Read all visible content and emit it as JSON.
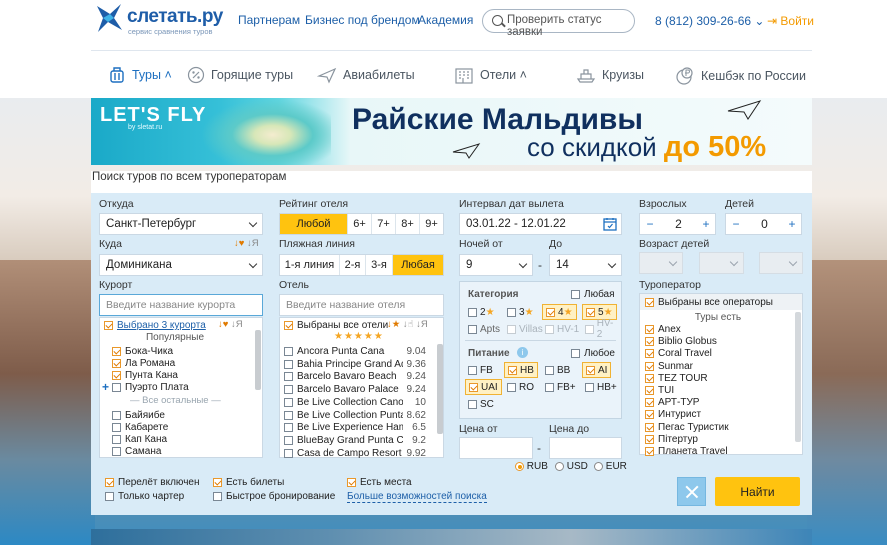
{
  "header": {
    "logo_text": "слетать.ру",
    "logo_sub": "сервис сравнения туров",
    "links": [
      "Партнерам",
      "Бизнес под брендом",
      "Академия"
    ],
    "status_btn": "Проверить статус заявки",
    "phone": "8 (812) 309-26-66 ⌄",
    "login": "Войти"
  },
  "nav": {
    "items": [
      "Туры",
      "Горящие туры",
      "Авиабилеты",
      "Отели",
      "Круизы",
      "Кешбэк по России"
    ]
  },
  "banner": {
    "brand": "LET'S FLY",
    "brand_sub": "by sletat.ru",
    "title": "Райские Мальдивы",
    "sub_prefix": "со скидкой ",
    "sub_hl": "до 50%"
  },
  "caption": "Поиск туров по всем туроператорам",
  "form": {
    "from_label": "Откуда",
    "from_value": "Санкт-Петербург",
    "to_label": "Куда",
    "to_value": "Доминикана",
    "resort_label": "Курорт",
    "resort_placeholder": "Введите название курорта",
    "resort_selected": "Выбрано 3 курорта",
    "resort_sort": "↓Я",
    "resort_popular": "Популярные",
    "resort_popular_items": [
      {
        "n": "Бока-Чика",
        "c": true
      },
      {
        "n": "Ла Романа",
        "c": true
      },
      {
        "n": "Пунта Кана",
        "c": true
      },
      {
        "n": "Пуэрто Плата",
        "c": false,
        "plus": true
      }
    ],
    "resort_rest": "Все остальные",
    "resort_rest_items": [
      "Байяибе",
      "Кабарете",
      "Кап Кана",
      "Самана"
    ],
    "rating_label": "Рейтинг отеля",
    "rating_opts": [
      "Любой",
      "6+",
      "7+",
      "8+",
      "9+"
    ],
    "beach_label": "Пляжная линия",
    "beach_opts": [
      "1-я линия",
      "2-я",
      "3-я",
      "Любая"
    ],
    "hotel_label": "Отель",
    "hotel_placeholder": "Введите название отеля",
    "hotel_selected": "Выбраны все отели",
    "hotel_sort": "↓Я",
    "hotel_stars": "★★★★★",
    "hotels": [
      {
        "n": "Ancora Punta Cana",
        "r": "9.04"
      },
      {
        "n": "Bahia Principe Grand Aqu",
        "r": "9.36"
      },
      {
        "n": "Barcelo Bavaro Beach",
        "r": "9.24"
      },
      {
        "n": "Barcelo Bavaro Palace",
        "r": "9.24"
      },
      {
        "n": "Be Live Collection Canoa",
        "r": "10"
      },
      {
        "n": "Be Live Collection Punta C",
        "r": "8.62"
      },
      {
        "n": "Be Live Experience Hama",
        "r": "6.5"
      },
      {
        "n": "BlueBay Grand Punta Can",
        "r": "9.2"
      },
      {
        "n": "Casa de Campo Resort &",
        "r": "9.92"
      }
    ],
    "dates_label": "Интервал дат вылета",
    "dates_value": "03.01.22 - 12.01.22",
    "nights_from_label": "Ночей от",
    "nights_from": "9",
    "nights_to_label": "До",
    "nights_to": "14",
    "nights_dash": "-",
    "category_label": "Категория",
    "category_any": "Любая",
    "cats": [
      {
        "n": "2",
        "c": false
      },
      {
        "n": "3",
        "c": false
      },
      {
        "n": "4",
        "c": true
      },
      {
        "n": "5",
        "c": true
      }
    ],
    "cats2": [
      "Apts",
      "Villas",
      "HV-1",
      "HV-2"
    ],
    "meal_label": "Питание",
    "meal_info": "i",
    "meal_any": "Любое",
    "meals": [
      {
        "n": "FB",
        "c": false
      },
      {
        "n": "HB",
        "c": true
      },
      {
        "n": "BB",
        "c": false
      },
      {
        "n": "AI",
        "c": true
      },
      {
        "n": "UAI",
        "c": true
      },
      {
        "n": "RO",
        "c": false
      },
      {
        "n": "FB+",
        "c": false
      },
      {
        "n": "HB+",
        "c": false
      },
      {
        "n": "SC",
        "c": false
      }
    ],
    "price_from_label": "Цена от",
    "price_to_label": "Цена до",
    "currencies": [
      "RUB",
      "USD",
      "EUR"
    ],
    "adults_label": "Взрослых",
    "adults": "2",
    "children_label": "Детей",
    "children": "0",
    "child_age_label": "Возраст детей",
    "operator_label": "Туроператор",
    "operator_all": "Выбраны все операторы",
    "operator_section": "Туры есть",
    "operators": [
      "Anex",
      "Biblio Globus",
      "Coral Travel",
      "Sunmar",
      "TEZ TOUR",
      "TUI",
      "АРТ-ТУР",
      "Интурист",
      "Пегас Туристик",
      "Пітертур",
      "Планета Travel"
    ],
    "bottom_checks": [
      {
        "n": "Перелёт включен",
        "c": true
      },
      {
        "n": "Только чартер",
        "c": false
      },
      {
        "n": "Есть билеты",
        "c": true
      },
      {
        "n": "Быстрое бронирование",
        "c": false
      },
      {
        "n": "Есть места",
        "c": true
      }
    ],
    "more_link": "Больше возможностей поиска",
    "find_btn": "Найти"
  },
  "colors": {
    "accent": "#ffc30f",
    "brand": "#1d5fa8",
    "form_bg": "#d9ebf7"
  }
}
